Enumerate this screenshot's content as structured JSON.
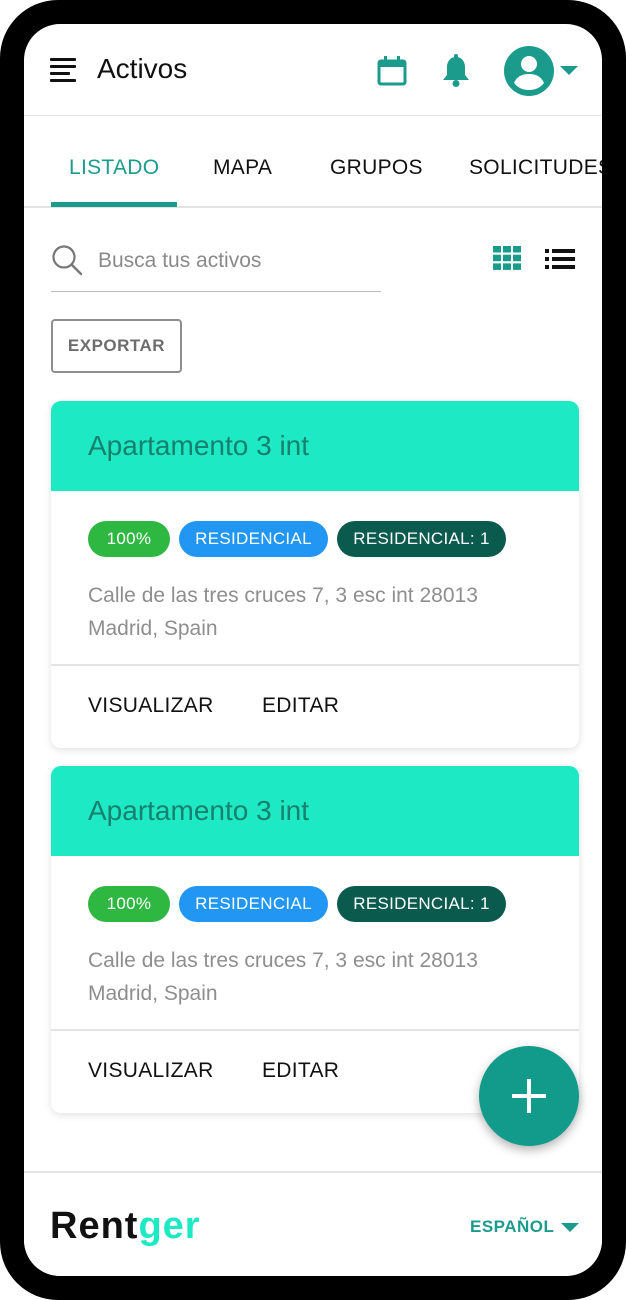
{
  "header": {
    "title": "Activos",
    "menu_icon": "hamburger-menu-icon",
    "calendar_icon": "calendar-icon",
    "notifications_icon": "bell-icon",
    "account_icon": "account-circle-icon",
    "accent_color": "#1a9b8c"
  },
  "tabs": [
    {
      "label": "LISTADO",
      "active": true
    },
    {
      "label": "MAPA",
      "active": false
    },
    {
      "label": "GRUPOS",
      "active": false
    },
    {
      "label": "SOLICITUDES",
      "active": false
    }
  ],
  "search": {
    "placeholder": "Busca tus activos",
    "value": ""
  },
  "view_toggle": {
    "grid_icon": "grid-view-icon",
    "list_icon": "list-view-icon"
  },
  "export_label": "EXPORTAR",
  "assets": [
    {
      "title": "Apartamento 3 int",
      "completion": "100%",
      "type": "RESIDENCIAL",
      "count": "RESIDENCIAL: 1",
      "address_line1": "Calle de las tres cruces 7, 3 esc int 28013",
      "address_line2": "Madrid, Spain",
      "view_label": "VISUALIZAR",
      "edit_label": "EDITAR"
    },
    {
      "title": "Apartamento 3 int",
      "completion": "100%",
      "type": "RESIDENCIAL",
      "count": "RESIDENCIAL: 1",
      "address_line1": "Calle de las tres cruces 7, 3 esc int 28013",
      "address_line2": "Madrid, Spain",
      "view_label": "VISUALIZAR",
      "edit_label": "EDITAR"
    }
  ],
  "fab_icon": "plus-icon",
  "footer": {
    "logo_part1": "Rent",
    "logo_part2": "ger",
    "language": "ESPAÑOL"
  },
  "colors": {
    "card_header": "#1de9c4",
    "chip_percent": "#2eb842",
    "chip_type": "#2196f3",
    "chip_count": "#0a5a4e",
    "fab": "#129a8a"
  }
}
